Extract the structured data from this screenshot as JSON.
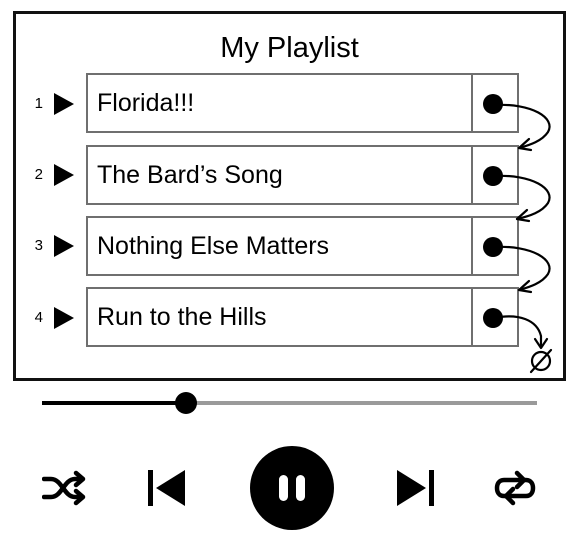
{
  "playlist": {
    "title": "My Playlist",
    "tracks": [
      {
        "number": "1",
        "title": "Florida!!!"
      },
      {
        "number": "2",
        "title": "The Bard’s Song"
      },
      {
        "number": "3",
        "title": "Nothing Else Matters"
      },
      {
        "number": "4",
        "title": "Run to the Hills"
      }
    ],
    "next_link_icon": "curved-arrow-icon",
    "end_of_list_icon": "null-set-icon"
  },
  "player": {
    "progress_fraction": 0.29,
    "controls": [
      {
        "icon": "shuffle-icon"
      },
      {
        "icon": "previous-icon"
      },
      {
        "icon": "pause-icon",
        "state": "playing"
      },
      {
        "icon": "next-icon"
      },
      {
        "icon": "repeat-icon"
      }
    ]
  }
}
